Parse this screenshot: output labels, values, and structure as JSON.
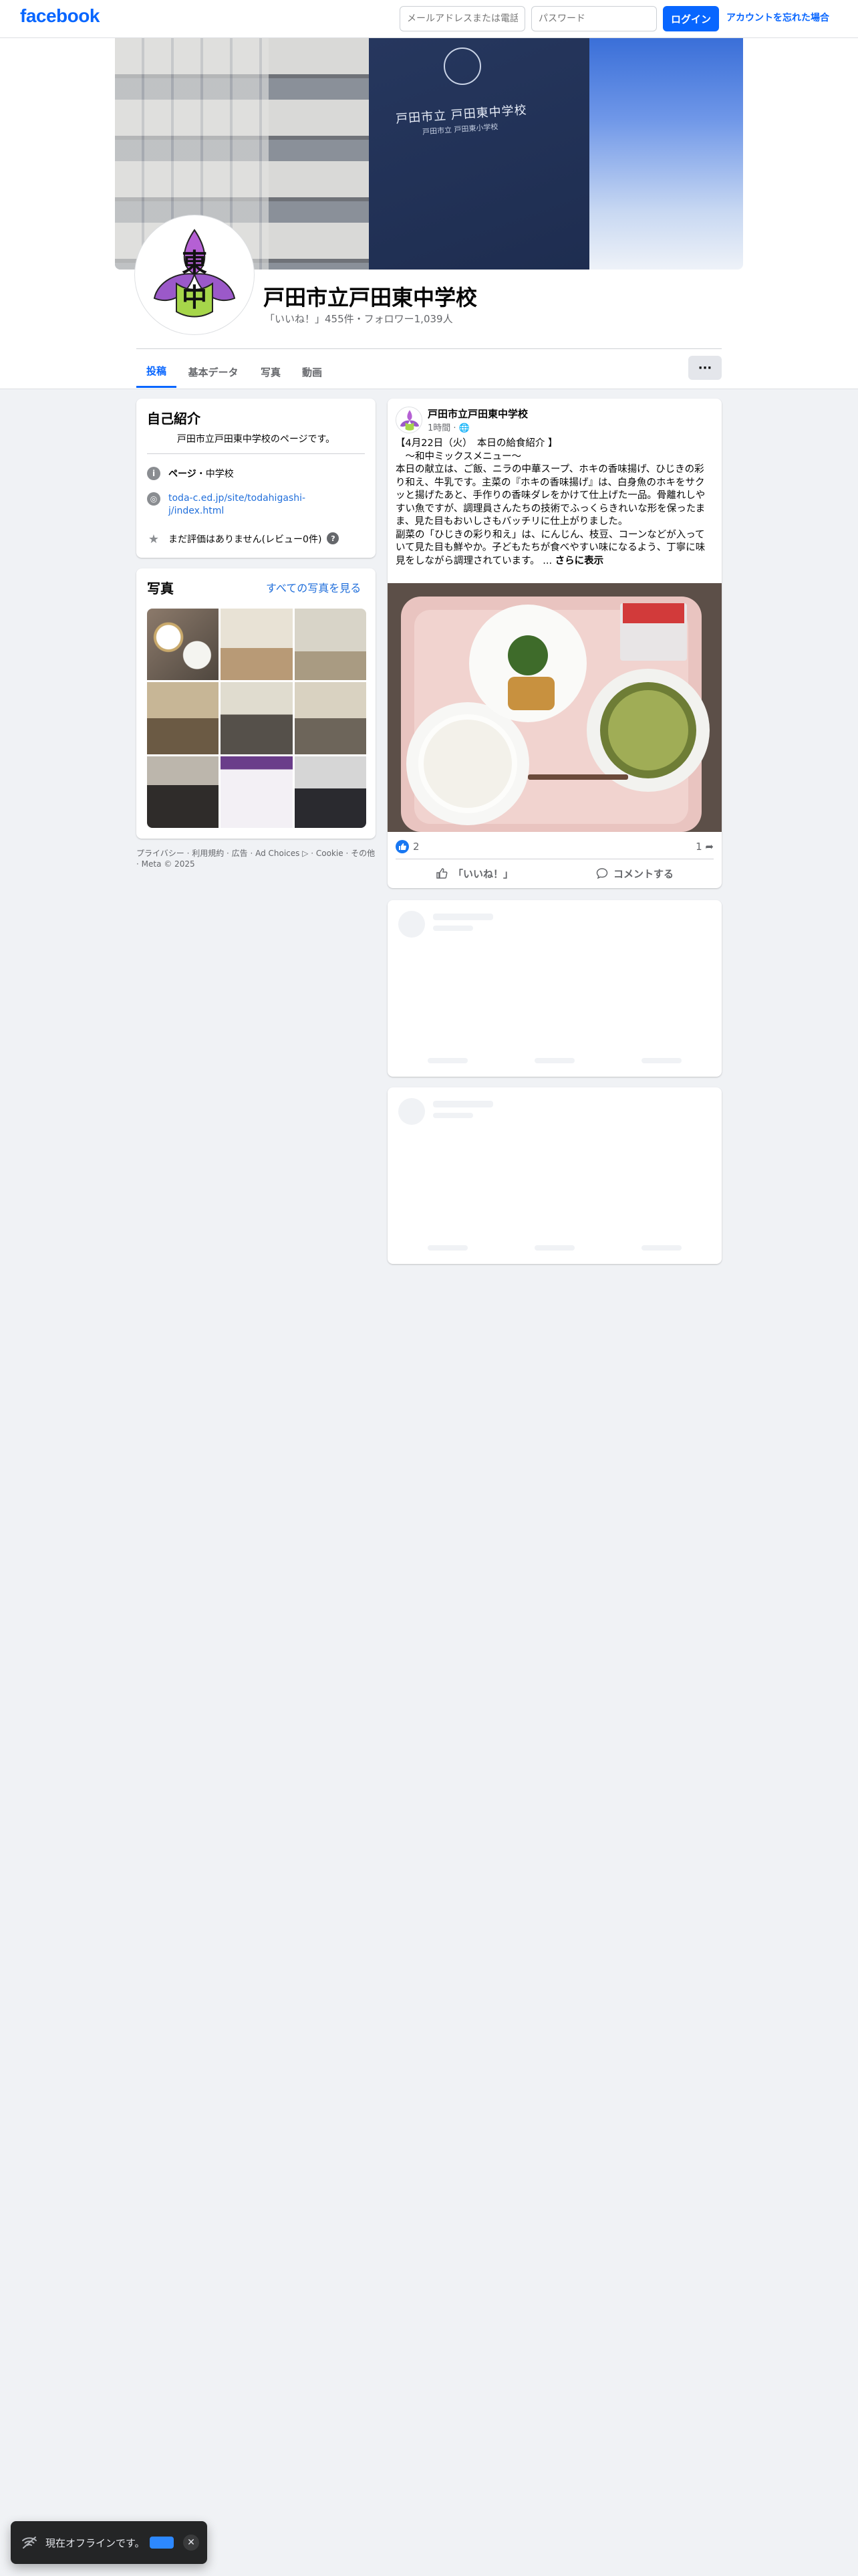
{
  "nav": {
    "logo": "facebook",
    "email_placeholder": "メールアドレスまたは電話番号",
    "password_placeholder": "パスワード",
    "login_label": "ログイン",
    "forgot_label": "アカウントを忘れた場合"
  },
  "cover": {
    "panel_text": "戸田市立 戸田東中学校",
    "panel_sub": "戸田市立 戸田東小学校"
  },
  "avatar": {
    "glyph_top": "東",
    "glyph_bottom": "中"
  },
  "page": {
    "title": "戸田市立戸田東中学校",
    "stats": "「いいね！」455件・フォロワー1,039人"
  },
  "tabs": [
    {
      "label": "投稿",
      "active": true
    },
    {
      "label": "基本データ",
      "active": false
    },
    {
      "label": "写真",
      "active": false
    },
    {
      "label": "動画",
      "active": false
    }
  ],
  "more_label": "···",
  "intro": {
    "title": "自己紹介",
    "bio": "戸田市立戸田東中学校のページです。",
    "category_prefix": "ページ",
    "category_value": "・中学校",
    "website": "toda-c.ed.jp/site/todahigashi-j/index.html",
    "rating": "まだ評価はありません(レビュー0件)",
    "help_icon": "?"
  },
  "photos": {
    "title": "写真",
    "see_all": "すべての写真を見る",
    "tiles": [
      "meal-photo",
      "classroom-photo",
      "presentation-photo",
      "lecture-photo",
      "meeting-photo",
      "workshop-photo",
      "seminar-photo",
      "slide-photo",
      "group-photo"
    ]
  },
  "footer": {
    "links": "プライバシー · 利用規約 · 広告 · Ad Choices ▷ · Cookie · その他 · Meta © 2025"
  },
  "post": {
    "author": "戸田市立戸田東中学校",
    "time": "1時間 · 🌐",
    "body": "【4月22日（火）　本日の給食紹介 】\n　～和中ミックスメニュー～\n本日の献立は、ご飯、ニラの中華スープ、ホキの香味揚げ、ひじきの彩り和え、牛乳です。主菜の『ホキの香味揚げ』は、白身魚のホキをサクッと揚げたあと、手作りの香味ダレをかけて仕上げた一品。骨離れしやすい魚ですが、調理員さんたちの技術でふっくらきれいな形を保ったまま、見た目もおいしさもバッチリに仕上がりました。\n副菜の「ひじきの彩り和え」は、にんじん、枝豆、コーンなどが入っていて見た目も鮮やか。子どもたちが食べやすい味になるよう、丁寧に味見をしながら調理されています。 ... ",
    "see_more": "さらに表示",
    "like_count": "2",
    "share_count": "1",
    "like_action": "「いいね！」",
    "comment_action": "コメントする"
  },
  "offline": {
    "text": "現在オフラインです。",
    "close": "✕"
  },
  "colors": {
    "brand": "#0866ff",
    "link": "#216fdb",
    "background": "#f0f2f5"
  }
}
